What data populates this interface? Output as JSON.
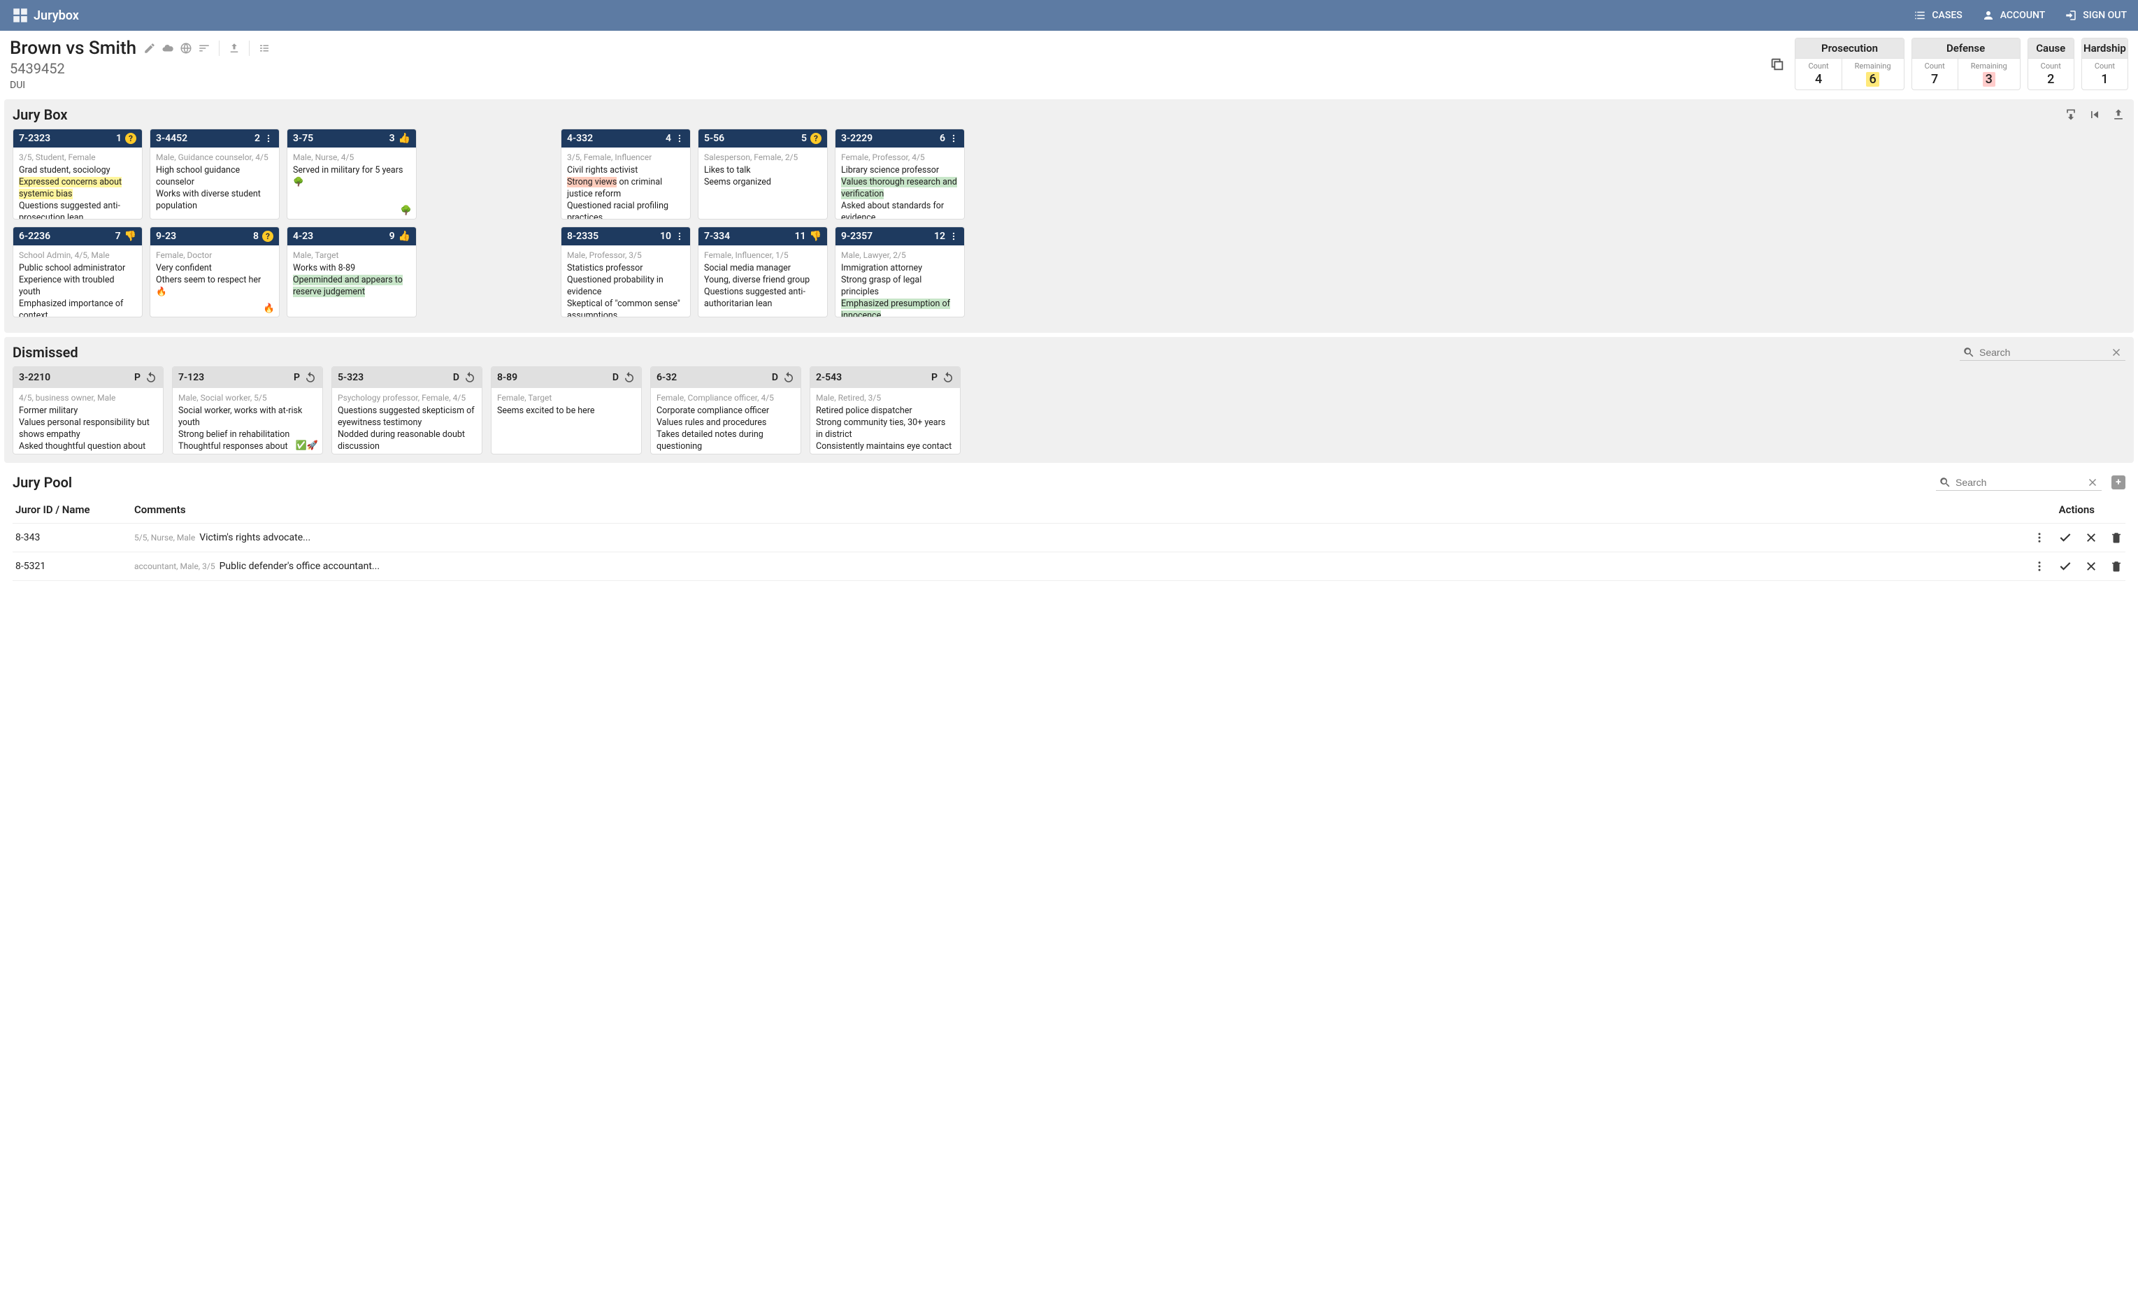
{
  "app": {
    "name": "Jurybox"
  },
  "nav": {
    "cases": "CASES",
    "account": "ACCOUNT",
    "signout": "SIGN OUT"
  },
  "case": {
    "title": "Brown vs Smith",
    "number": "5439452",
    "type": "DUI"
  },
  "counters": [
    {
      "title": "Prosecution",
      "cells": [
        {
          "label": "Count",
          "value": "4"
        },
        {
          "label": "Remaining",
          "value": "6",
          "hl": "yellow"
        }
      ]
    },
    {
      "title": "Defense",
      "cells": [
        {
          "label": "Count",
          "value": "7"
        },
        {
          "label": "Remaining",
          "value": "3",
          "hl": "red"
        }
      ]
    },
    {
      "title": "Cause",
      "cells": [
        {
          "label": "Count",
          "value": "2"
        }
      ]
    },
    {
      "title": "Hardship",
      "cells": [
        {
          "label": "Count",
          "value": "1"
        }
      ]
    }
  ],
  "sections": {
    "jurybox": "Jury Box",
    "dismissed": "Dismissed",
    "pool": "Jury Pool"
  },
  "search_placeholder": "Search",
  "jurybox": {
    "row1": [
      {
        "id": "7-2323",
        "num": "1",
        "badge": "q",
        "meta": "3/5, Student, Female",
        "notes": [
          {
            "t": "Grad student, sociology"
          },
          {
            "t": "Expressed concerns about systemic bias",
            "hl": "y"
          },
          {
            "t": "Questions suggested anti-prosecution lean"
          }
        ]
      },
      {
        "id": "3-4452",
        "num": "2",
        "badge": "menu",
        "meta": "Male, Guidance counselor, 4/5",
        "notes": [
          {
            "t": "High school guidance counselor"
          },
          {
            "t": "Works with diverse student population"
          }
        ]
      },
      {
        "id": "3-75",
        "num": "3",
        "badge": "up",
        "meta": "Male, Nurse, 4/5",
        "notes": [
          {
            "t": "Served in military for 5 years"
          },
          {
            "t": "🌳"
          }
        ],
        "emoji": "🌳"
      },
      null,
      {
        "id": "4-332",
        "num": "4",
        "badge": "menu",
        "meta": "3/5, Female, Influencer",
        "notes": [
          {
            "t": "Civil rights activist"
          },
          {
            "t": "Strong views",
            "hl": "o",
            "append": " on criminal justice reform"
          },
          {
            "t": "Questioned racial profiling practices"
          }
        ]
      },
      {
        "id": "5-56",
        "num": "5",
        "badge": "q",
        "meta": "Salesperson, Female, 2/5",
        "notes": [
          {
            "t": "Likes to talk"
          },
          {
            "t": "Seems organized"
          }
        ]
      },
      {
        "id": "3-2229",
        "num": "6",
        "badge": "menu",
        "meta": "Female, Professor, 4/5",
        "notes": [
          {
            "t": "Library science professor"
          },
          {
            "t": "Values thorough research and verification",
            "hl": "g"
          },
          {
            "t": "Asked about standards for evidence"
          }
        ]
      }
    ],
    "row2": [
      {
        "id": "6-2236",
        "num": "7",
        "badge": "down",
        "meta": "School Admin, 4/5, Male",
        "notes": [
          {
            "t": "Public school administrator"
          },
          {
            "t": "Experience with troubled youth"
          },
          {
            "t": "Emphasized importance of context"
          }
        ]
      },
      {
        "id": "9-23",
        "num": "8",
        "badge": "q",
        "meta": "Female, Doctor",
        "notes": [
          {
            "t": "Very confident"
          },
          {
            "t": "Others seem to respect her 🔥"
          }
        ],
        "emoji": "🔥"
      },
      {
        "id": "4-23",
        "num": "9",
        "badge": "up",
        "meta": "Male, Target",
        "notes": [
          {
            "t": "Works with 8-89"
          },
          {
            "t": "Openminded and appears to reserve judgement",
            "hl": "g"
          }
        ]
      },
      null,
      {
        "id": "8-2335",
        "num": "10",
        "badge": "menu",
        "meta": "Male, Professor, 3/5",
        "notes": [
          {
            "t": "Statistics professor"
          },
          {
            "t": "Questioned probability in evidence"
          },
          {
            "t": "Skeptical of \"common sense\" assumptions"
          }
        ]
      },
      {
        "id": "7-334",
        "num": "11",
        "badge": "down",
        "meta": "Female, Influencer, 1/5",
        "notes": [
          {
            "t": "Social media manager"
          },
          {
            "t": "Young, diverse friend group"
          },
          {
            "t": "Questions suggested anti-authoritarian lean"
          }
        ]
      },
      {
        "id": "9-2357",
        "num": "12",
        "badge": "menu",
        "meta": "Male, Lawyer, 2/5",
        "notes": [
          {
            "t": "Immigration attorney"
          },
          {
            "t": "Strong grasp of legal principles"
          },
          {
            "t": "Emphasized presumption of innocence",
            "hl": "g"
          }
        ]
      }
    ]
  },
  "dismissed": [
    {
      "id": "3-2210",
      "by": "P",
      "meta": "4/5, business owner, Male",
      "notes": [
        "Former military",
        "Values personal responsibility but shows empathy",
        "Asked thoughtful question about burden of proof"
      ]
    },
    {
      "id": "7-123",
      "by": "P",
      "meta": "Male, Social worker, 5/5",
      "notes": [
        "Social worker, works with at-risk youth",
        "Strong belief in rehabilitation",
        "Thoughtful responses about circumstantial evidence"
      ],
      "emoji": "✅🚀"
    },
    {
      "id": "5-323",
      "by": "D",
      "meta": "Psychology professor, Female, 4/5",
      "notes": [
        "Questions suggested skepticism of eyewitness testimony",
        "Nodded during reasonable doubt discussion"
      ]
    },
    {
      "id": "8-89",
      "by": "D",
      "meta": "Female, Target",
      "notes": [
        "Seems excited to be here"
      ]
    },
    {
      "id": "6-32",
      "by": "D",
      "meta": "Female, Compliance officer, 4/5",
      "notes": [
        "Corporate compliance officer",
        "Values rules and procedures",
        "Takes detailed notes during questioning"
      ]
    },
    {
      "id": "2-543",
      "by": "P",
      "meta": "Male, Retired, 3/5",
      "notes": [
        "Retired police dispatcher",
        "Strong community ties, 30+ years in district",
        "Consistently maintains eye contact"
      ]
    }
  ],
  "pool": {
    "headers": {
      "id": "Juror ID / Name",
      "comments": "Comments",
      "actions": "Actions"
    },
    "rows": [
      {
        "id": "8-343",
        "meta": "5/5, Nurse, Male",
        "comment": "Victim's rights advocate..."
      },
      {
        "id": "8-5321",
        "meta": "accountant, Male, 3/5",
        "comment": "Public defender's office accountant..."
      }
    ]
  }
}
